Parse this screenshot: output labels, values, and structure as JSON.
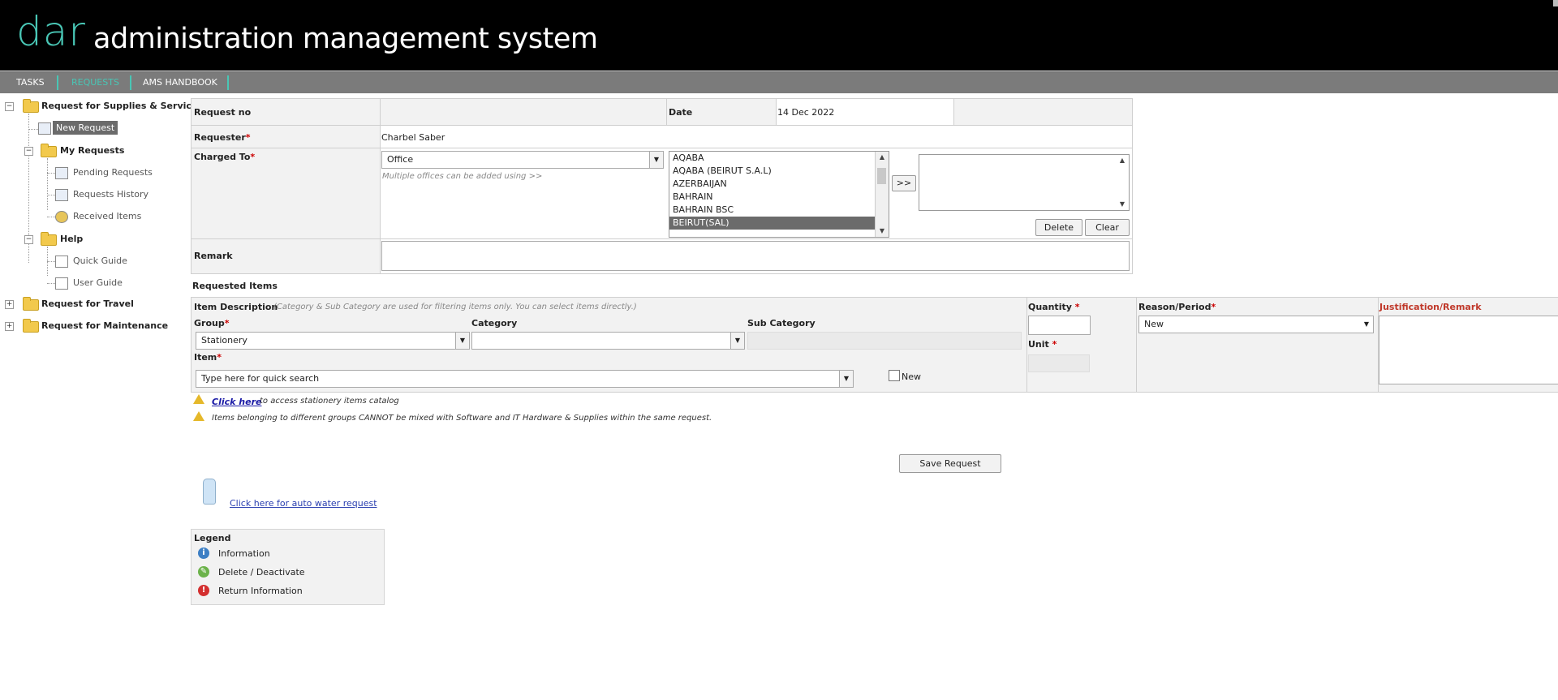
{
  "header": {
    "logo": "dar",
    "title": "administration management system"
  },
  "nav": {
    "items": [
      "TASKS",
      "REQUESTS",
      "AMS HANDBOOK"
    ],
    "active": "REQUESTS"
  },
  "tree": {
    "root1": "Request for Supplies & Services",
    "new_request": "New Request",
    "my_requests": "My Requests",
    "pending": "Pending Requests",
    "history": "Requests History",
    "received": "Received Items",
    "help": "Help",
    "quick_guide": "Quick Guide",
    "user_guide": "User Guide",
    "travel": "Request for Travel",
    "maintenance": "Request for Maintenance"
  },
  "form": {
    "request_no_label": "Request no",
    "date_label": "Date",
    "date_value": "14 Dec 2022",
    "requester_label": "Requester",
    "requester_value": "Charbel Saber",
    "charged_to_label": "Charged To",
    "charged_to_select": "Office",
    "charged_hint": "Multiple offices can be added using >>",
    "offices": [
      "AQABA",
      "AQABA (BEIRUT S.A.L)",
      "AZERBAIJAN",
      "BAHRAIN",
      "BAHRAIN BSC",
      "BEIRUT(SAL)"
    ],
    "offices_selected": "BEIRUT(SAL)",
    "add_button": ">>",
    "delete_button": "Delete",
    "clear_button": "Clear",
    "remark_label": "Remark"
  },
  "items": {
    "section_title": "Requested Items",
    "desc_label": "Item Description",
    "desc_hint": "(Category & Sub Category are used for filtering items only. You can select items directly.)",
    "group_label": "Group",
    "group_value": "Stationery",
    "category_label": "Category",
    "subcategory_label": "Sub Category",
    "item_label": "Item",
    "item_placeholder": "Type here for quick search",
    "new_label": "New",
    "quantity_label": "Quantity",
    "unit_label": "Unit",
    "reason_label": "Reason/Period",
    "reason_value": "New",
    "justification_label": "Justification/Remark",
    "catalog_link": "Click here",
    "catalog_text": "to access stationery items catalog",
    "warning_text": "Items belonging to different groups CANNOT be mixed with Software and IT Hardware & Supplies within the same request."
  },
  "save_button": "Save Request",
  "water_link": "Click here for auto water request",
  "legend": {
    "title": "Legend",
    "information": "Information",
    "delete": "Delete / Deactivate",
    "return": "Return Information"
  },
  "colors": {
    "accent": "#49c6b5",
    "nav": "#7b7b7b",
    "required": "#cc0000"
  }
}
